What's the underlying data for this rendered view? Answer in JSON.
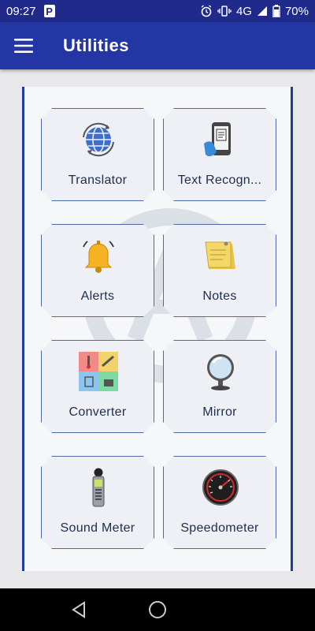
{
  "status": {
    "time": "09:27",
    "network": "4G",
    "battery": "70%"
  },
  "appbar": {
    "title": "Utilities"
  },
  "tiles": [
    {
      "label": "Translator"
    },
    {
      "label": "Text Recogn..."
    },
    {
      "label": "Alerts"
    },
    {
      "label": "Notes"
    },
    {
      "label": "Converter"
    },
    {
      "label": "Mirror"
    },
    {
      "label": "Sound Meter"
    },
    {
      "label": "Speedometer"
    }
  ],
  "colors": {
    "statusbar": "#1f2a8a",
    "appbar": "#2436a3",
    "panel_border": "#1f3d9e",
    "tile_border": "#4c6aa8"
  }
}
